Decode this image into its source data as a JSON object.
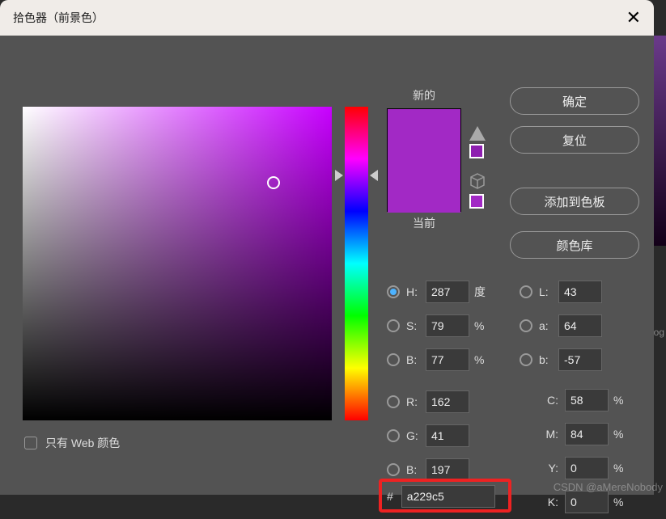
{
  "title": "拾色器（前景色）",
  "swatch": {
    "new_label": "新的",
    "current_label": "当前"
  },
  "buttons": {
    "ok": "确定",
    "reset": "复位",
    "add_swatch": "添加到色板",
    "libraries": "颜色库"
  },
  "hsb": {
    "h": {
      "label": "H:",
      "value": "287",
      "unit": "度"
    },
    "s": {
      "label": "S:",
      "value": "79",
      "unit": "%"
    },
    "b": {
      "label": "B:",
      "value": "77",
      "unit": "%"
    }
  },
  "lab": {
    "l": {
      "label": "L:",
      "value": "43"
    },
    "a": {
      "label": "a:",
      "value": "64"
    },
    "b": {
      "label": "b:",
      "value": "-57"
    }
  },
  "rgb": {
    "r": {
      "label": "R:",
      "value": "162"
    },
    "g": {
      "label": "G:",
      "value": "41"
    },
    "b": {
      "label": "B:",
      "value": "197"
    }
  },
  "cmyk": {
    "c": {
      "label": "C:",
      "value": "58",
      "unit": "%"
    },
    "m": {
      "label": "M:",
      "value": "84",
      "unit": "%"
    },
    "y": {
      "label": "Y:",
      "value": "0",
      "unit": "%"
    },
    "k": {
      "label": "K:",
      "value": "0",
      "unit": "%"
    }
  },
  "hex": {
    "hash": "#",
    "value": "a229c5"
  },
  "web_only": "只有 Web 颜色",
  "watermark": "CSDN @aMereNobody",
  "bg_text": "og"
}
